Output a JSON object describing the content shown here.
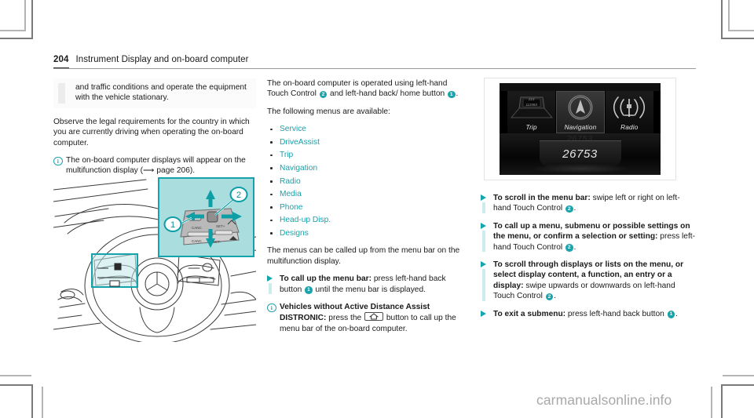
{
  "header": {
    "page_number": "204",
    "title": "Instrument Display and on-board computer"
  },
  "left_column": {
    "warning_text": "and traffic conditions and operate the equipment with the vehicle stationary.",
    "paragraph": "Observe the legal requirements for the country in which you are currently driving when operating the on-board computer.",
    "note_icon": "i",
    "note_text": "The on-board computer displays will appear on the multifunction display (⟶ page 206)."
  },
  "middle_column": {
    "intro_part1": "The on-board computer is operated using left-hand Touch Control",
    "intro_badge_a": "2",
    "intro_part2": "and left-hand back/ home button",
    "intro_badge_b": "1",
    "intro_part3": ".",
    "menus_intro": "The following menus are available:",
    "menu_items": [
      "Service",
      "DriveAssist",
      "Trip",
      "Navigation",
      "Radio",
      "Media",
      "Phone",
      "Head-up Disp.",
      "Designs"
    ],
    "menubar_paragraph": "The menus can be called up from the menu bar on the multifunction display.",
    "action_callup": {
      "bold": "To call up the menu bar:",
      "text_part1": "press left-hand back button",
      "badge": "1",
      "text_part2": "until the menu bar is displayed."
    },
    "note_distronic": {
      "icon": "i",
      "bold_line1": "Vehicles without Active Distance Assist",
      "bold_line2": "DISTRONIC:",
      "text_part1": "press the",
      "key_icon": "home-key",
      "text_part2": "button to call up the menu bar of the on-board computer."
    }
  },
  "right_column": {
    "actions": [
      {
        "bold": "To scroll in the menu bar:",
        "text_part1": "swipe left or right on left-hand Touch Control",
        "badge": "2",
        "text_part2": "."
      },
      {
        "bold": "To call up a menu, submenu or possible settings on the menu, or confirm a selection or setting:",
        "text_part1": "press left-hand Touch Control",
        "badge": "2",
        "text_part2": "."
      },
      {
        "bold": "To scroll through displays or lists on the menu, or select display content, a function, an entry or a display:",
        "text_part1": "swipe upwards or downwards on left-hand Touch Control",
        "badge": "2",
        "text_part2": "."
      },
      {
        "bold": "To exit a submenu:",
        "text_part1": "press left-hand back button",
        "badge": "1",
        "text_part2": "."
      }
    ]
  },
  "figure_wheel": {
    "caption_badges": [
      "1",
      "2"
    ],
    "control_labels": [
      "CANC",
      "SET+",
      "SET-"
    ]
  },
  "figure_display": {
    "menu_tiles": [
      {
        "label": "Trip",
        "selected": false,
        "icon": "trip-icon"
      },
      {
        "label": "Navigation",
        "selected": true,
        "icon": "navigation-compass-icon"
      },
      {
        "label": "Radio",
        "selected": false,
        "icon": "radio-antenna-icon"
      }
    ],
    "trip_value_top": "213",
    "trip_value_bottom": "111984",
    "odometer": "26753"
  },
  "watermark": "carmanualsonline.info",
  "colors": {
    "teal": "#1aa3ab",
    "teal_light": "#cdecee",
    "link_teal": "#18a2aa"
  }
}
